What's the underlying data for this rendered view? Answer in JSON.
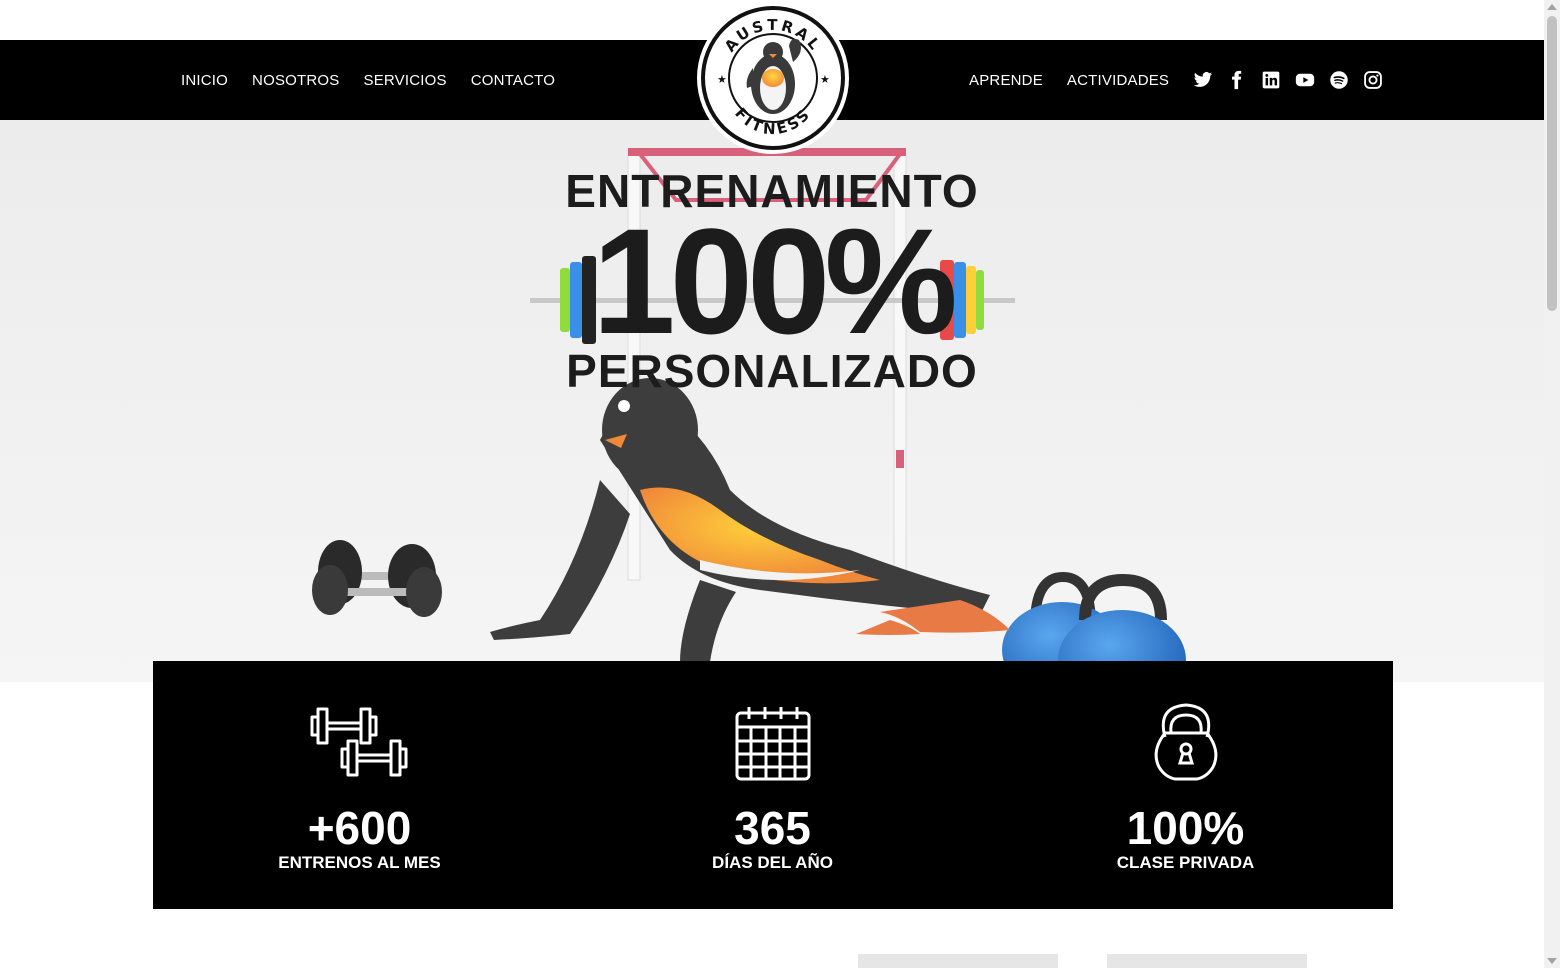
{
  "nav": {
    "left": [
      "INICIO",
      "NOSOTROS",
      "SERVICIOS",
      "CONTACTO"
    ],
    "right": [
      "APRENDE",
      "ACTIVIDADES"
    ],
    "socials": [
      "twitter-icon",
      "facebook-icon",
      "linkedin-icon",
      "youtube-icon",
      "spotify-icon",
      "instagram-icon"
    ]
  },
  "logo": {
    "top_text": "AUSTRAL",
    "bottom_text": "FITNESS"
  },
  "hero": {
    "line1": "ENTRENAMIENTO",
    "line2": "100%",
    "line3": "PERSONALIZADO"
  },
  "stats": [
    {
      "icon": "dumbbells-icon",
      "value": "+600",
      "label": "ENTRENOS AL MES"
    },
    {
      "icon": "calendar-icon",
      "value": "365",
      "label": "DÍAS DEL AÑO"
    },
    {
      "icon": "kettlebell-icon",
      "value": "100%",
      "label": "CLASE PRIVADA"
    }
  ],
  "colors": {
    "header_bg": "#000000",
    "hero_bg": "#e9e9e9",
    "accent_orange": "#f08a3a",
    "kettlebell_blue": "#2f7fd8"
  }
}
